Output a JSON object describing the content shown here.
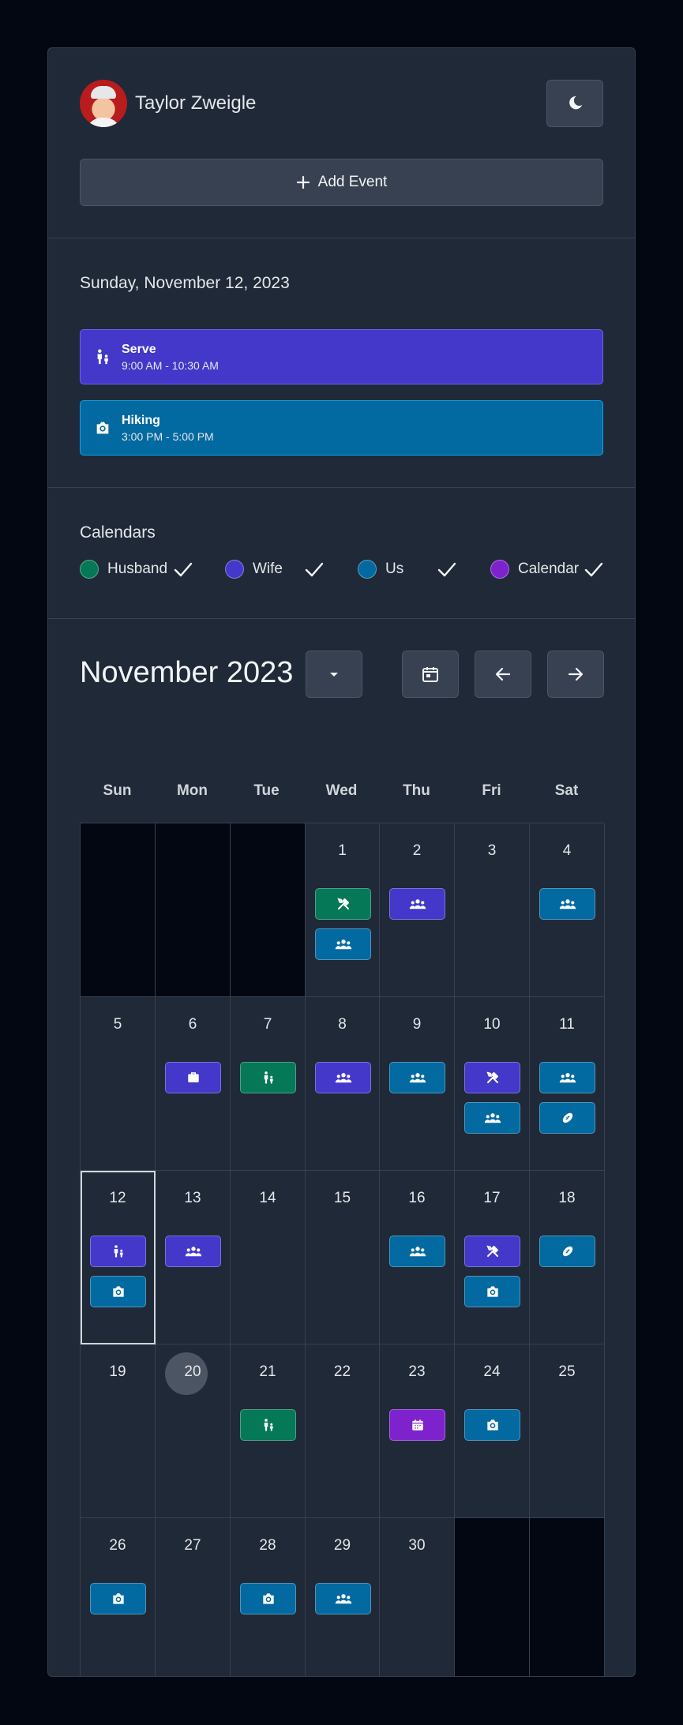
{
  "header": {
    "user_name": "Taylor Zweigle",
    "avatar_icon": "user-avatar",
    "theme_toggle_icon": "moon-icon",
    "add_event_label": "Add Event",
    "add_event_icon": "plus-icon"
  },
  "agenda": {
    "date": "Sunday, November 12, 2023",
    "events": [
      {
        "title": "Serve",
        "time": "9:00 AM - 10:30 AM",
        "icon": "serve-icon",
        "calendar": "Wife",
        "color": "#4338ca"
      },
      {
        "title": "Hiking",
        "time": "3:00 PM - 5:00 PM",
        "icon": "camera-icon",
        "calendar": "Us",
        "color": "#0369a1"
      }
    ]
  },
  "calendars": {
    "heading": "Calendars",
    "items": [
      {
        "label": "Husband",
        "color": "#047857",
        "checked": true
      },
      {
        "label": "Wife",
        "color": "#4338ca",
        "checked": true
      },
      {
        "label": "Us",
        "color": "#0369a1",
        "checked": true
      },
      {
        "label": "Calendar",
        "color": "#7e22ce",
        "checked": true
      }
    ]
  },
  "month": {
    "title": "November 2023",
    "dropdown_icon": "caret-down-icon",
    "today_icon": "calendar-icon",
    "prev_icon": "arrow-left-icon",
    "next_icon": "arrow-right-icon",
    "weekdays": [
      "Sun",
      "Mon",
      "Tue",
      "Wed",
      "Thu",
      "Fri",
      "Sat"
    ],
    "selected_day": 12,
    "current_day": 20,
    "weeks": [
      [
        null,
        null,
        null,
        1,
        2,
        3,
        4
      ],
      [
        5,
        6,
        7,
        8,
        9,
        10,
        11
      ],
      [
        12,
        13,
        14,
        15,
        16,
        17,
        18
      ],
      [
        19,
        20,
        21,
        22,
        23,
        24,
        25
      ],
      [
        26,
        27,
        28,
        29,
        30,
        null,
        null
      ]
    ],
    "day_events": {
      "1": [
        {
          "icon": "tools-icon",
          "calendar": "Husband"
        },
        {
          "icon": "people-icon",
          "calendar": "Us"
        }
      ],
      "2": [
        {
          "icon": "people-icon",
          "calendar": "Wife"
        }
      ],
      "4": [
        {
          "icon": "people-icon",
          "calendar": "Us"
        }
      ],
      "6": [
        {
          "icon": "briefcase-icon",
          "calendar": "Wife"
        }
      ],
      "7": [
        {
          "icon": "serve-icon",
          "calendar": "Husband"
        }
      ],
      "8": [
        {
          "icon": "people-icon",
          "calendar": "Wife"
        }
      ],
      "9": [
        {
          "icon": "people-icon",
          "calendar": "Us"
        }
      ],
      "10": [
        {
          "icon": "tools-icon",
          "calendar": "Wife"
        },
        {
          "icon": "people-icon",
          "calendar": "Us"
        }
      ],
      "11": [
        {
          "icon": "people-icon",
          "calendar": "Us"
        },
        {
          "icon": "football-icon",
          "calendar": "Us"
        }
      ],
      "12": [
        {
          "icon": "serve-icon",
          "calendar": "Wife"
        },
        {
          "icon": "camera-icon",
          "calendar": "Us"
        }
      ],
      "13": [
        {
          "icon": "people-icon",
          "calendar": "Wife"
        }
      ],
      "16": [
        {
          "icon": "people-icon",
          "calendar": "Us"
        }
      ],
      "17": [
        {
          "icon": "tools-icon",
          "calendar": "Wife"
        },
        {
          "icon": "camera-icon",
          "calendar": "Us"
        }
      ],
      "18": [
        {
          "icon": "football-icon",
          "calendar": "Us"
        }
      ],
      "21": [
        {
          "icon": "serve-icon",
          "calendar": "Husband"
        }
      ],
      "23": [
        {
          "icon": "calendar-icon",
          "calendar": "Calendar"
        }
      ],
      "24": [
        {
          "icon": "camera-icon",
          "calendar": "Us"
        }
      ],
      "26": [
        {
          "icon": "camera-icon",
          "calendar": "Us"
        }
      ],
      "28": [
        {
          "icon": "camera-icon",
          "calendar": "Us"
        }
      ],
      "29": [
        {
          "icon": "people-icon",
          "calendar": "Us"
        }
      ]
    }
  }
}
